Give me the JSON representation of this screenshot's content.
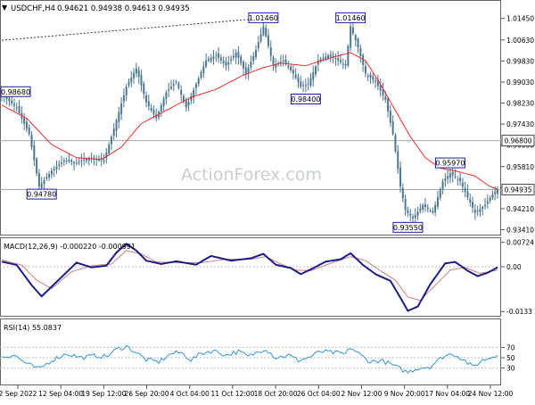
{
  "header": {
    "symbol": "USDCHF,H4",
    "ohlc": "0.94621 0.94938 0.94613 0.94935"
  },
  "watermark": "ActionForex.com",
  "colors": {
    "candle": "#4a7590",
    "ma": "#e83030",
    "hline": "#a8a8a8",
    "label_border": "#1e1e9a",
    "macd_line": "#1c1c88",
    "macd_signal": "#d08080",
    "rsi_line": "#3296dc",
    "watermark": "#c9cfd6"
  },
  "chart_data": [
    {
      "type": "candlestick",
      "name": "price",
      "ylim": [
        0.9329,
        1.0205
      ],
      "y_ticks": [
        "1.01450",
        "1.00630",
        "0.99830",
        "0.99030",
        "0.98230",
        "0.97430",
        "0.96630",
        "0.95810",
        "0.95010",
        "0.94210",
        "0.93410"
      ],
      "x_ticks": [
        "2 Sep 2022",
        "12 Sep 04:00",
        "19 Sep 12:00",
        "26 Sep 20:00",
        "4 Oct 04:00",
        "11 Oct 12:00",
        "18 Oct 20:00",
        "26 Oct 04:00",
        "2 Nov 12:00",
        "9 Nov 20:00",
        "17 Nov 04:00",
        "24 Nov 12:00"
      ],
      "current_price": "0.94935",
      "horizontal_levels": [
        {
          "label": "0.96800",
          "value": 0.968
        },
        {
          "label": "0.94935",
          "value": 0.94935
        }
      ],
      "annotations": [
        {
          "text": "0.98680",
          "value": 0.9868,
          "bar": 0
        },
        {
          "text": "0.94780",
          "value": 0.9478,
          "bar": 16
        },
        {
          "text": "1.01460",
          "value": 1.0146,
          "bar": 105
        },
        {
          "text": "0.98400",
          "value": 0.984,
          "bar": 122
        },
        {
          "text": "1.01460",
          "value": 1.0146,
          "bar": 140
        },
        {
          "text": "0.93550",
          "value": 0.9355,
          "bar": 163
        },
        {
          "text": "0.95970",
          "value": 0.9597,
          "bar": 180
        }
      ],
      "trendline": [
        [
          0,
          1.0062
        ],
        [
          105,
          1.0146
        ]
      ],
      "anchors": [
        [
          0,
          0.9855
        ],
        [
          6,
          0.9805
        ],
        [
          11,
          0.9705
        ],
        [
          15,
          0.9505
        ],
        [
          20,
          0.9565
        ],
        [
          25,
          0.9605
        ],
        [
          30,
          0.9595
        ],
        [
          35,
          0.9615
        ],
        [
          41,
          0.9605
        ],
        [
          45,
          0.9725
        ],
        [
          50,
          0.9885
        ],
        [
          54,
          0.9955
        ],
        [
          58,
          0.9825
        ],
        [
          62,
          0.9765
        ],
        [
          66,
          0.9865
        ],
        [
          70,
          0.9905
        ],
        [
          74,
          0.9805
        ],
        [
          78,
          0.9895
        ],
        [
          82,
          0.9985
        ],
        [
          86,
          1.0005
        ],
        [
          90,
          0.9965
        ],
        [
          94,
          1.0015
        ],
        [
          98,
          0.9935
        ],
        [
          102,
          1.0025
        ],
        [
          105,
          1.0115
        ],
        [
          109,
          0.9965
        ],
        [
          113,
          0.9985
        ],
        [
          117,
          0.9935
        ],
        [
          120,
          0.9885
        ],
        [
          123,
          0.9895
        ],
        [
          127,
          0.9985
        ],
        [
          131,
          1.0005
        ],
        [
          135,
          0.9985
        ],
        [
          138,
          0.9965
        ],
        [
          140,
          1.0115
        ],
        [
          143,
          1.0035
        ],
        [
          146,
          0.9935
        ],
        [
          150,
          0.9905
        ],
        [
          154,
          0.9835
        ],
        [
          157,
          0.9705
        ],
        [
          160,
          0.9505
        ],
        [
          162,
          0.9415
        ],
        [
          165,
          0.9385
        ],
        [
          169,
          0.9435
        ],
        [
          173,
          0.9405
        ],
        [
          177,
          0.9525
        ],
        [
          180,
          0.9555
        ],
        [
          184,
          0.9525
        ],
        [
          187,
          0.9465
        ],
        [
          190,
          0.9405
        ],
        [
          194,
          0.9435
        ],
        [
          197,
          0.9475
        ],
        [
          199,
          0.94935
        ]
      ],
      "ma_anchors": [
        [
          0,
          0.9815
        ],
        [
          10,
          0.9765
        ],
        [
          20,
          0.9665
        ],
        [
          30,
          0.9615
        ],
        [
          40,
          0.9608
        ],
        [
          48,
          0.9655
        ],
        [
          56,
          0.9745
        ],
        [
          66,
          0.9795
        ],
        [
          76,
          0.9845
        ],
        [
          86,
          0.9875
        ],
        [
          96,
          0.9925
        ],
        [
          104,
          0.9955
        ],
        [
          112,
          0.9975
        ],
        [
          122,
          0.9965
        ],
        [
          132,
          0.9995
        ],
        [
          140,
          1.0015
        ],
        [
          146,
          0.9985
        ],
        [
          152,
          0.9895
        ],
        [
          158,
          0.9795
        ],
        [
          164,
          0.9695
        ],
        [
          170,
          0.9615
        ],
        [
          176,
          0.9575
        ],
        [
          182,
          0.9565
        ],
        [
          190,
          0.9545
        ],
        [
          196,
          0.9505
        ],
        [
          199,
          0.9495
        ]
      ]
    },
    {
      "type": "line",
      "name": "MACD(12,26,9) -0.000220 -0.000991",
      "ylim": [
        -0.0143,
        0.0082
      ],
      "y_ticks": [
        "0.00724",
        "0.00",
        "-0.0133"
      ],
      "series": [
        {
          "name": "MACD",
          "anchors": [
            [
              0,
              0.0015
            ],
            [
              6,
              0.0005
            ],
            [
              12,
              -0.0055
            ],
            [
              16,
              -0.0088
            ],
            [
              22,
              -0.0045
            ],
            [
              30,
              0.0012
            ],
            [
              36,
              -0.0002
            ],
            [
              42,
              0.0003
            ],
            [
              46,
              0.0042
            ],
            [
              50,
              0.0068
            ],
            [
              54,
              0.0048
            ],
            [
              58,
              0.0018
            ],
            [
              64,
              0.0008
            ],
            [
              70,
              0.0016
            ],
            [
              78,
              0.0006
            ],
            [
              84,
              0.0032
            ],
            [
              92,
              0.0018
            ],
            [
              100,
              0.0025
            ],
            [
              105,
              0.0038
            ],
            [
              110,
              0.0006
            ],
            [
              116,
              -0.0004
            ],
            [
              120,
              -0.0022
            ],
            [
              124,
              -0.0008
            ],
            [
              130,
              0.0015
            ],
            [
              136,
              0.0022
            ],
            [
              140,
              0.004
            ],
            [
              145,
              0.0005
            ],
            [
              150,
              -0.0022
            ],
            [
              156,
              -0.0042
            ],
            [
              160,
              -0.0092
            ],
            [
              163,
              -0.0131
            ],
            [
              167,
              -0.0118
            ],
            [
              172,
              -0.0052
            ],
            [
              178,
              0.001
            ],
            [
              182,
              0.0014
            ],
            [
              187,
              -0.0012
            ],
            [
              191,
              -0.0028
            ],
            [
              195,
              -0.0018
            ],
            [
              199,
              -0.0002
            ]
          ]
        },
        {
          "name": "Signal",
          "anchors": [
            [
              0,
              0.002
            ],
            [
              8,
              0.0005
            ],
            [
              14,
              -0.004
            ],
            [
              20,
              -0.0065
            ],
            [
              28,
              -0.0015
            ],
            [
              36,
              0.0003
            ],
            [
              44,
              0.0008
            ],
            [
              50,
              0.0048
            ],
            [
              56,
              0.0038
            ],
            [
              62,
              0.0014
            ],
            [
              70,
              0.0012
            ],
            [
              80,
              0.0012
            ],
            [
              90,
              0.0022
            ],
            [
              100,
              0.0022
            ],
            [
              106,
              0.003
            ],
            [
              112,
              0.0008
            ],
            [
              118,
              -0.001
            ],
            [
              124,
              -0.0012
            ],
            [
              132,
              0.001
            ],
            [
              140,
              0.003
            ],
            [
              146,
              0.0018
            ],
            [
              152,
              -0.0012
            ],
            [
              158,
              -0.004
            ],
            [
              163,
              -0.009
            ],
            [
              168,
              -0.01
            ],
            [
              174,
              -0.0055
            ],
            [
              180,
              -0.001
            ],
            [
              186,
              -0.0002
            ],
            [
              192,
              -0.002
            ],
            [
              199,
              -0.001
            ]
          ]
        }
      ]
    },
    {
      "type": "line",
      "name": "RSI(14) 55.0837",
      "ylim": [
        0,
        100
      ],
      "y_ticks": [
        "70",
        "50",
        "30"
      ],
      "series": [
        {
          "name": "RSI",
          "anchors": [
            [
              0,
              52
            ],
            [
              5,
              55
            ],
            [
              10,
              38
            ],
            [
              15,
              28
            ],
            [
              20,
              45
            ],
            [
              26,
              58
            ],
            [
              32,
              50
            ],
            [
              38,
              54
            ],
            [
              42,
              52
            ],
            [
              46,
              66
            ],
            [
              50,
              72
            ],
            [
              54,
              60
            ],
            [
              58,
              46
            ],
            [
              63,
              42
            ],
            [
              68,
              58
            ],
            [
              72,
              60
            ],
            [
              76,
              46
            ],
            [
              80,
              58
            ],
            [
              85,
              64
            ],
            [
              90,
              55
            ],
            [
              95,
              62
            ],
            [
              99,
              52
            ],
            [
              104,
              64
            ],
            [
              106,
              68
            ],
            [
              110,
              50
            ],
            [
              115,
              55
            ],
            [
              119,
              45
            ],
            [
              123,
              50
            ],
            [
              128,
              62
            ],
            [
              133,
              60
            ],
            [
              138,
              57
            ],
            [
              140,
              70
            ],
            [
              144,
              55
            ],
            [
              148,
              42
            ],
            [
              152,
              45
            ],
            [
              156,
              38
            ],
            [
              160,
              28
            ],
            [
              163,
              22
            ],
            [
              167,
              30
            ],
            [
              172,
              33
            ],
            [
              177,
              52
            ],
            [
              181,
              58
            ],
            [
              185,
              48
            ],
            [
              189,
              32
            ],
            [
              193,
              45
            ],
            [
              197,
              52
            ],
            [
              199,
              55
            ]
          ]
        }
      ]
    }
  ]
}
